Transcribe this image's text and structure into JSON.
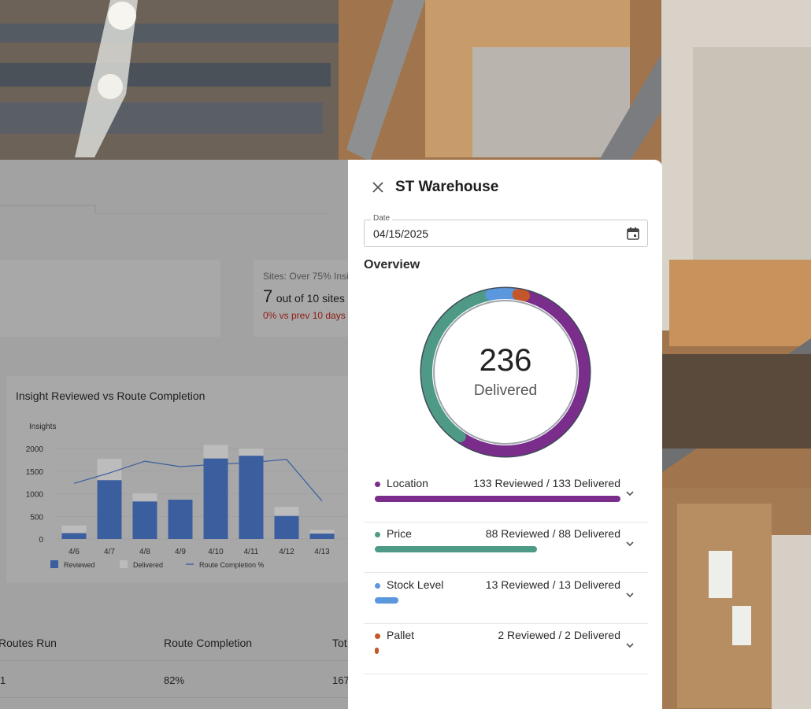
{
  "colors": {
    "location": "#7b2d8c",
    "price": "#4e9a86",
    "stock_level": "#5b97dd",
    "pallet": "#c4572a",
    "bar_reviewed": "#3b5e9e",
    "bar_delivered": "#bcbcbc",
    "delta_red": "#8e1d16"
  },
  "dashboard": {
    "kpi": {
      "title": "Sites: Over 75% Insi",
      "value": "7",
      "value_suffix": "out of 10 sites",
      "delta": "0% vs prev 10 days"
    },
    "chart_title": "Insight Reviewed vs Route Completion",
    "table": {
      "headers": [
        "Routes Run",
        "Route Completion",
        "Tot"
      ],
      "row": [
        "1",
        "82%",
        "167"
      ]
    }
  },
  "chart_data": {
    "type": "bar",
    "title": "Insight Reviewed vs Route Completion",
    "ylabel": "Insights",
    "ylim": [
      0,
      2000
    ],
    "yticks": [
      "0",
      "500",
      "1000",
      "1500",
      "2000"
    ],
    "categories": [
      "4/6",
      "4/7",
      "4/8",
      "4/9",
      "4/10",
      "4/11",
      "4/12",
      "4/13"
    ],
    "series": [
      {
        "name": "Reviewed",
        "values": [
          130,
          1300,
          830,
          870,
          1780,
          1840,
          510,
          120
        ]
      },
      {
        "name": "Delivered",
        "values": [
          300,
          1770,
          1010,
          870,
          2080,
          2000,
          710,
          200
        ]
      },
      {
        "name": "Route Completion %",
        "type": "line",
        "values": [
          1230,
          1460,
          1720,
          1600,
          1650,
          1690,
          1760,
          840
        ]
      }
    ],
    "legend": [
      "Reviewed",
      "Delivered",
      "Route Completion %"
    ],
    "legend_position": "bottom"
  },
  "panel": {
    "title": "ST Warehouse",
    "date_label": "Date",
    "date_value": "04/15/2025",
    "overview_label": "Overview",
    "total": "236",
    "total_label": "Delivered",
    "metrics": [
      {
        "name": "Location",
        "values": "133 Reviewed / 133 Delivered",
        "count": 133,
        "color": "#7b2d8c"
      },
      {
        "name": "Price",
        "values": "88 Reviewed / 88 Delivered",
        "count": 88,
        "color": "#4e9a86"
      },
      {
        "name": "Stock Level",
        "values": "13 Reviewed / 13 Delivered",
        "count": 13,
        "color": "#5b97dd"
      },
      {
        "name": "Pallet",
        "values": "2 Reviewed / 2 Delivered",
        "count": 2,
        "color": "#c4572a"
      }
    ]
  }
}
